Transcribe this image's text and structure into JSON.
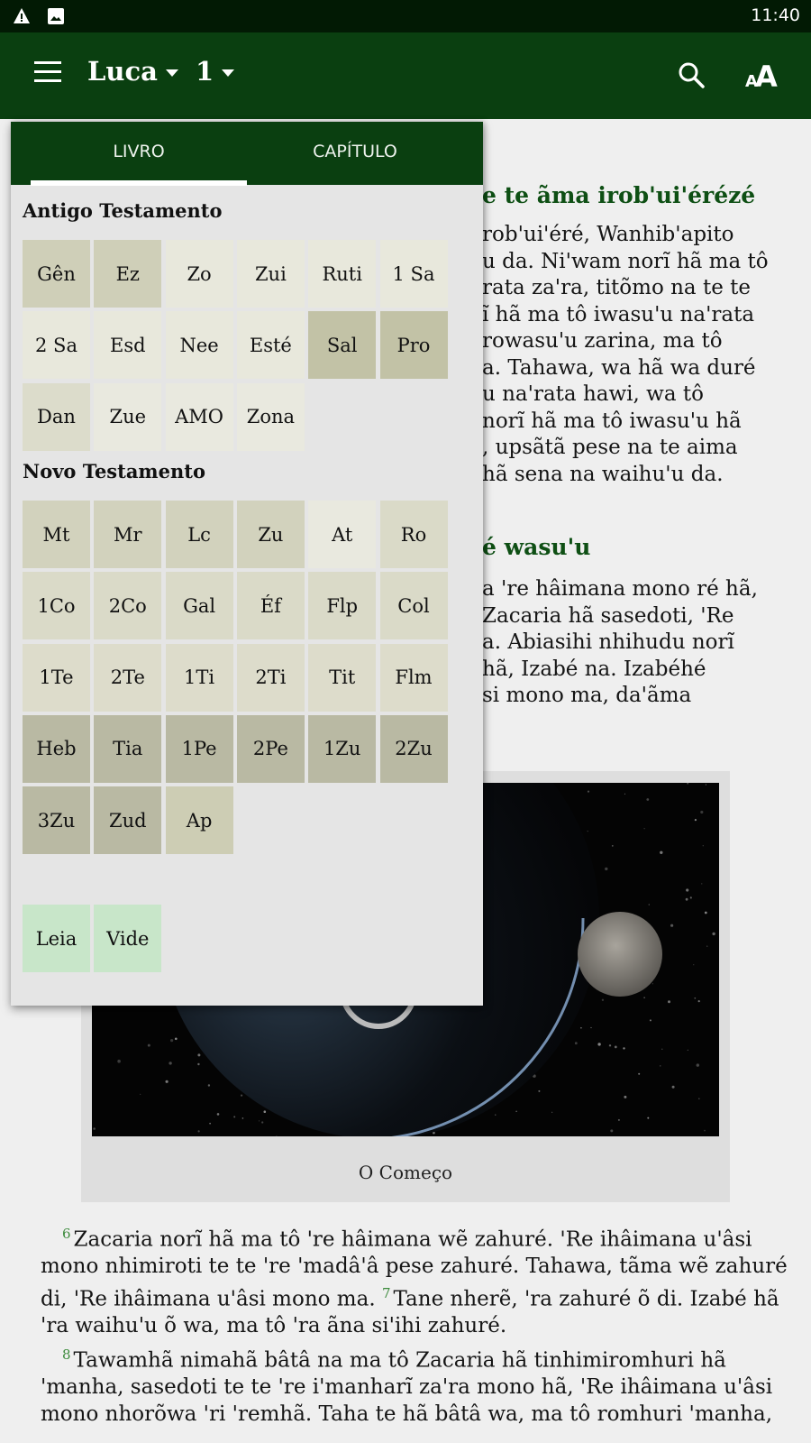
{
  "status_bar": {
    "time": "11:40",
    "icons": [
      "warning-icon",
      "image-icon"
    ]
  },
  "app_bar": {
    "book": "Luca",
    "chapter": "1",
    "menu_icon": "hamburger-menu-icon",
    "search_icon": "search-icon",
    "text_size_icon": "text-size-icon",
    "color": "#0a3f10"
  },
  "panel": {
    "tabs": [
      {
        "label": "LIVRO",
        "selected": true
      },
      {
        "label": "CAPÍTULO",
        "selected": false
      }
    ],
    "old_testament": {
      "title": "Antigo Testamento",
      "books": [
        {
          "label": "Gên",
          "color": "#cfcfb8"
        },
        {
          "label": "Ez",
          "color": "#cfcfb8"
        },
        {
          "label": "Zo",
          "color": "#e8e8dc"
        },
        {
          "label": "Zui",
          "color": "#e8e8dc"
        },
        {
          "label": "Ruti",
          "color": "#e8e8dc"
        },
        {
          "label": "1 Sa",
          "color": "#e8e8dc"
        },
        {
          "label": "2 Sa",
          "color": "#e8e8dc"
        },
        {
          "label": "Esd",
          "color": "#e8e8dc"
        },
        {
          "label": "Nee",
          "color": "#e8e8dc"
        },
        {
          "label": "Esté",
          "color": "#e8e8dc"
        },
        {
          "label": "Sal",
          "color": "#c2c2a6"
        },
        {
          "label": "Pro",
          "color": "#c2c2a6"
        },
        {
          "label": "Dan",
          "color": "#dcdccb"
        },
        {
          "label": "Zue",
          "color": "#e9e9df"
        },
        {
          "label": "AMO",
          "color": "#e9e9df"
        },
        {
          "label": "Zona",
          "color": "#e9e9df"
        }
      ]
    },
    "new_testament": {
      "title": "Novo Testamento",
      "books": [
        {
          "label": "Mt",
          "color": "#d2d2bd"
        },
        {
          "label": "Mr",
          "color": "#d2d2bd"
        },
        {
          "label": "Lc",
          "color": "#d2d2bd"
        },
        {
          "label": "Zu",
          "color": "#d2d2bd"
        },
        {
          "label": "At",
          "color": "#e9e9df"
        },
        {
          "label": "Ro",
          "color": "#dadac8"
        },
        {
          "label": "1Co",
          "color": "#dadac8"
        },
        {
          "label": "2Co",
          "color": "#dadac8"
        },
        {
          "label": "Gal",
          "color": "#dadac8"
        },
        {
          "label": "Éf",
          "color": "#dadac8"
        },
        {
          "label": "Flp",
          "color": "#dadac8"
        },
        {
          "label": "Col",
          "color": "#dadac8"
        },
        {
          "label": "1Te",
          "color": "#dddccb"
        },
        {
          "label": "2Te",
          "color": "#dddccb"
        },
        {
          "label": "1Ti",
          "color": "#dddccb"
        },
        {
          "label": "2Ti",
          "color": "#dddccb"
        },
        {
          "label": "Tit",
          "color": "#dddccb"
        },
        {
          "label": "Flm",
          "color": "#dddccb"
        },
        {
          "label": "Heb",
          "color": "#b9b9a3"
        },
        {
          "label": "Tia",
          "color": "#b9b9a3"
        },
        {
          "label": "1Pe",
          "color": "#b9b9a3"
        },
        {
          "label": "2Pe",
          "color": "#b9b9a3"
        },
        {
          "label": "1Zu",
          "color": "#b9b9a3"
        },
        {
          "label": "2Zu",
          "color": "#b9b9a3"
        },
        {
          "label": "3Zu",
          "color": "#b9b9a3"
        },
        {
          "label": "Zud",
          "color": "#b9b9a3"
        },
        {
          "label": "Ap",
          "color": "#cdcdb4"
        }
      ]
    },
    "extras": [
      {
        "label": "Leia",
        "color": "#c8e6c9"
      },
      {
        "label": "Vide",
        "color": "#c8e6c9"
      }
    ]
  },
  "content": {
    "heading1": "e te ãma irob'ui'érézé",
    "para1": [
      "rob'ui'éré, Wanhib'apito",
      "u da. Ni'wam norĩ hã ma tô",
      "rata za'ra, titõmo na te te",
      "ĩ hã ma tô iwasu'u na'rata",
      "rowasu'u zarina, ma tô",
      "a. Tahawa, wa hã wa duré",
      "u na'rata hawi, wa tô",
      "norĩ hã ma tô iwasu'u hã",
      ", upsãtã pese na te aima",
      "hã sena na waihu'u da."
    ],
    "heading2": "é wasu'u",
    "para2": [
      "a 're hâimana mono ré hã,",
      "Zacaria hã sasedoti, 'Re",
      "a. Abiasihi nhihudu norĩ",
      " hã, Izabé na. Izabéhé",
      "si mono ma, da'ãma"
    ],
    "figure_caption": "O Começo",
    "verse6": {
      "num": "6",
      "line1": "Zacaria norĩ hã ma tô 're hâimana wẽ zahuré. 'Re ihâimana u'âsi",
      "line2": "mono nhimiroti te te 're 'madâ'â pese zahuré. Tahawa, tãma wẽ zahuré",
      "line3a": "di, 'Re ihâimana u'âsi mono ma. "
    },
    "verse7": {
      "num": "7",
      "line3b": "Tane nherẽ, 'ra zahuré õ di. Izabé hã",
      "line4": "'ra waihu'u õ wa, ma tô 'ra ãna si'ihi zahuré."
    },
    "verse8": {
      "num": "8",
      "line1": "Tawamhã nimahã bâtâ na ma tô Zacaria hã tinhimiromhuri hã",
      "line2": "'manha, sasedoti te te 're i'manharĩ za'ra mono hã, 'Re ihâimana u'âsi",
      "line3": "mono nhorõwa 'ri 'remhã. Taha te hã bâtâ wa, ma tô romhuri 'manha,"
    }
  }
}
